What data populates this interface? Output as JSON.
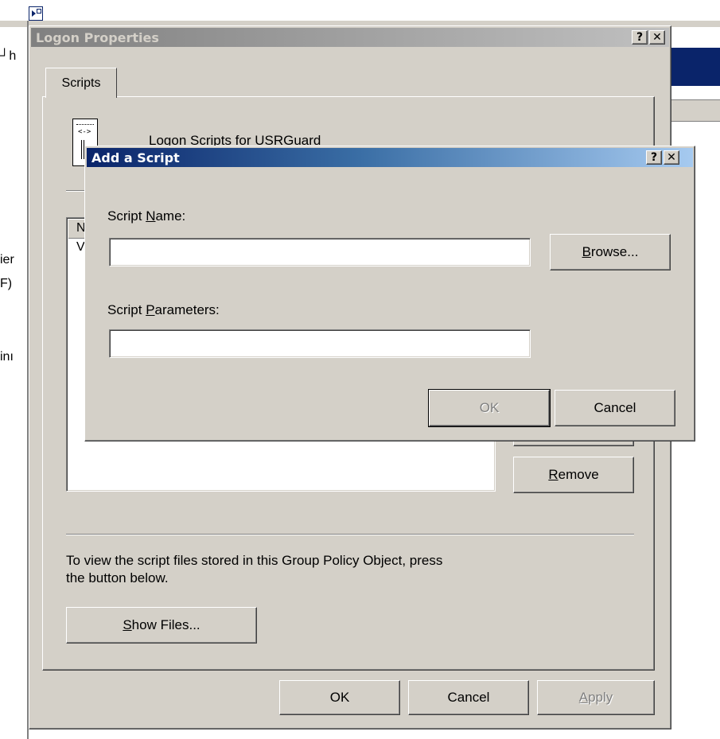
{
  "background": {
    "fragments": [
      "┘h",
      "ier",
      "F)",
      "inı"
    ]
  },
  "logon_props": {
    "title": "Logon Properties",
    "help_glyph": "?",
    "close_glyph": "✕",
    "tab_scripts": "Scripts",
    "heading_partial": "Logon Scripts for USRGuard",
    "list_header_partial": "N",
    "list_row_partial": "V",
    "remove_button": "Remove",
    "remove_accel": "R",
    "info_text_line1": "To view the script files stored in this Group Policy Object, press",
    "info_text_line2": "the button below.",
    "show_files_button": "Show Files...",
    "show_files_accel": "S",
    "ok_button": "OK",
    "cancel_button": "Cancel",
    "apply_button": "Apply",
    "apply_accel": "A"
  },
  "add_script": {
    "title": "Add a Script",
    "help_glyph": "?",
    "close_glyph": "✕",
    "script_name_label": "Script Name:",
    "script_name_accel": "N",
    "script_name_value": "",
    "browse_button": "Browse...",
    "browse_accel": "B",
    "script_params_label": "Script Parameters:",
    "script_params_accel": "P",
    "script_params_value": "",
    "ok_button": "OK",
    "cancel_button": "Cancel"
  },
  "colors": {
    "face": "#d4d0c8",
    "active_title_start": "#0a246a",
    "active_title_end": "#a6caf0",
    "inactive_title_start": "#808080",
    "inactive_title_end": "#c0c0c0"
  }
}
